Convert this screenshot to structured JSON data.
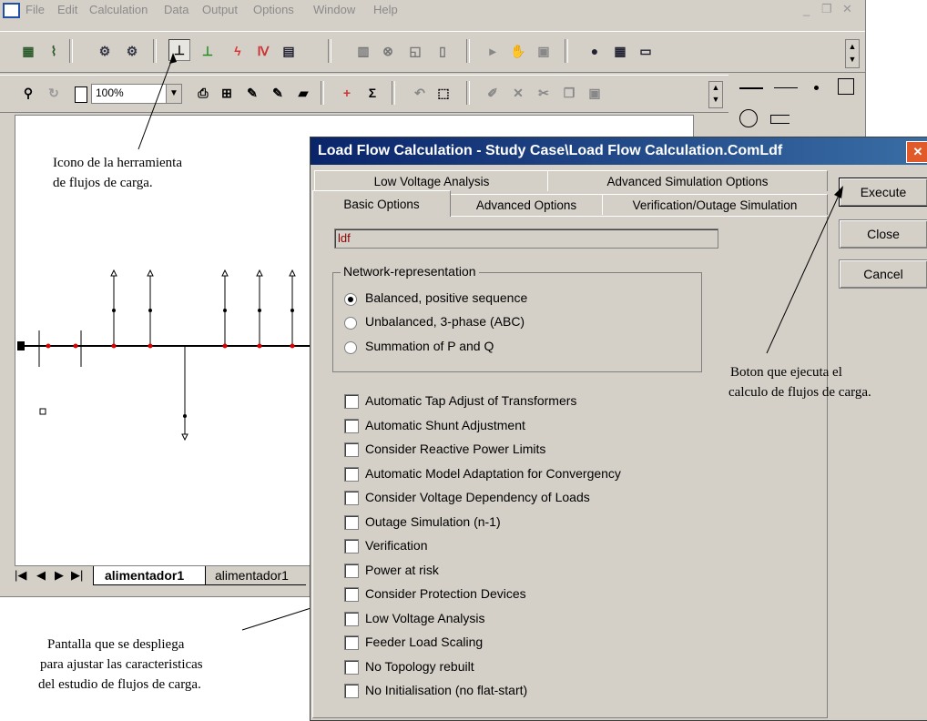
{
  "menu": [
    "File",
    "Edit",
    "Calculation",
    "Data",
    "Output",
    "Options",
    "Window",
    "Help"
  ],
  "toolbar": {
    "zoom_value": "100%"
  },
  "sheet_tabs": [
    "alimentador1",
    "alimentador1"
  ],
  "dialog": {
    "title": "Load Flow Calculation - Study Case\\Load Flow Calculation.ComLdf",
    "close_glyph": "✕",
    "tabs_row1": [
      "Low Voltage Analysis",
      "Advanced Simulation Options"
    ],
    "tabs_row2": [
      "Basic Options",
      "Advanced Options",
      "Verification/Outage Simulation"
    ],
    "name_value": "ldf",
    "group_title": "Network-representation",
    "radios": [
      {
        "label": "Balanced, positive sequence",
        "checked": true
      },
      {
        "label": "Unbalanced, 3-phase (ABC)",
        "checked": false
      },
      {
        "label": "Summation of P and Q",
        "checked": false
      }
    ],
    "checkboxes": [
      "Automatic Tap Adjust of Transformers",
      "Automatic Shunt Adjustment",
      "Consider Reactive Power Limits",
      "Automatic Model Adaptation for Convergency",
      "Consider Voltage Dependency of Loads",
      "Outage Simulation (n-1)",
      "Verification",
      "Power at risk",
      "Consider Protection Devices",
      "Low Voltage Analysis",
      "Feeder Load Scaling",
      "No Topology rebuilt",
      "No Initialisation (no flat-start)"
    ],
    "buttons": {
      "execute": "Execute",
      "close": "Close",
      "cancel": "Cancel"
    }
  },
  "annotations": {
    "toolbar_note": [
      "Icono de la herramienta",
      "de flujos de carga."
    ],
    "execute_note": [
      "Boton que ejecuta el",
      "calculo de flujos de carga."
    ],
    "dialog_note": [
      "Pantalla que se despliega",
      "para ajustar las caracteristicas",
      "del estudio de flujos de carga."
    ]
  }
}
